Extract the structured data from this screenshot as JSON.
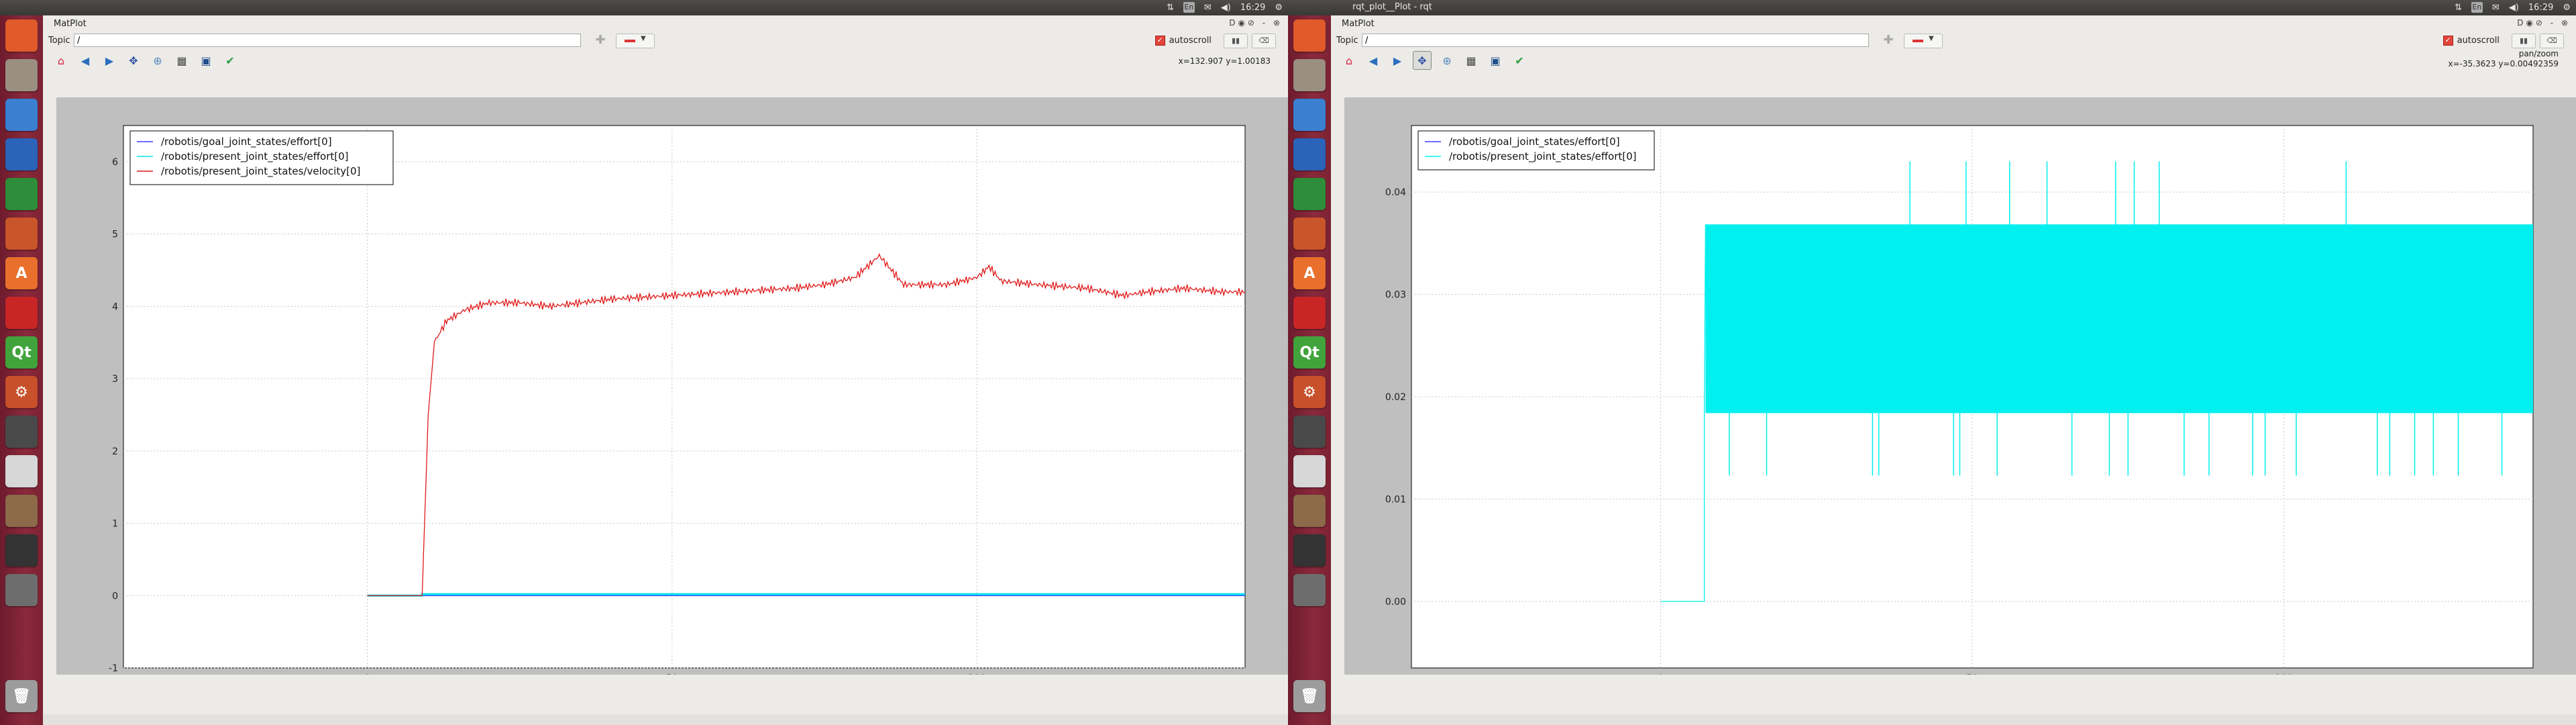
{
  "topbar": {
    "left_title": "",
    "right_title": "rqt_plot__Plot - rqt",
    "keyboard": "En",
    "clock": "16:29"
  },
  "launcher": {
    "items": [
      {
        "name": "dash",
        "label": "",
        "color": "#e05a2a"
      },
      {
        "name": "files",
        "label": "",
        "color": "#9a8f80"
      },
      {
        "name": "chromium",
        "label": "",
        "color": "#3a7fd0"
      },
      {
        "name": "writer",
        "label": "",
        "color": "#2a63b8"
      },
      {
        "name": "calc",
        "label": "",
        "color": "#2e8d3a"
      },
      {
        "name": "impress",
        "label": "",
        "color": "#c9552a"
      },
      {
        "name": "software-center",
        "label": "A",
        "color": "#e8702c"
      },
      {
        "name": "terminal-red",
        "label": "",
        "color": "#c82626"
      },
      {
        "name": "qt-creator",
        "label": "Qt",
        "color": "#41a33c"
      },
      {
        "name": "settings",
        "label": "⚙",
        "color": "#c8502a"
      },
      {
        "name": "eye",
        "label": "",
        "color": "#4a4a4a"
      },
      {
        "name": "editor",
        "label": "",
        "color": "#d7d7d7"
      },
      {
        "name": "gimp",
        "label": "",
        "color": "#8c6a4a"
      },
      {
        "name": "system-monitor",
        "label": "",
        "color": "#333"
      },
      {
        "name": "workspaces",
        "label": "",
        "color": "#6d6d6d"
      }
    ],
    "trash": "trash"
  },
  "windows": [
    {
      "title": "MatPlot",
      "topic_label": "Topic",
      "topic_value": "/",
      "autoscroll_label": "autoscroll",
      "coords": "x=132.907     y=1.00183",
      "coords_line1": "",
      "coords_line2": ""
    },
    {
      "title": "MatPlot",
      "topic_label": "Topic",
      "topic_value": "/",
      "autoscroll_label": "autoscroll",
      "coords": "",
      "coords_line1": "pan/zoom",
      "coords_line2": "x=-35.3623     y=0.00492359"
    }
  ],
  "chart_data": [
    {
      "type": "line",
      "xlim": [
        -40,
        144
      ],
      "ylim": [
        -1,
        6.5
      ],
      "xticks": [
        0,
        50,
        100
      ],
      "yticks": [
        -1,
        0,
        1,
        2,
        3,
        4,
        5,
        6
      ],
      "grid": true,
      "legend_position": "top-left",
      "series": [
        {
          "name": "/robotis/goal_joint_states/effort[0]",
          "color": "#3c3cff",
          "points": [
            [
              0,
              0
            ],
            [
              9,
              0
            ],
            [
              144,
              0
            ]
          ]
        },
        {
          "name": "/robotis/present_joint_states/effort[0]",
          "color": "#00e5ee",
          "points": [
            [
              0,
              0
            ],
            [
              9,
              0
            ],
            [
              9,
              0.02
            ],
            [
              144,
              0.02
            ]
          ]
        },
        {
          "name": "/robotis/present_joint_states/velocity[0]",
          "color": "#e01818",
          "points": [
            [
              0,
              0
            ],
            [
              9,
              0
            ],
            [
              10,
              2.5
            ],
            [
              11,
              3.5
            ],
            [
              13,
              3.8
            ],
            [
              16,
              3.95
            ],
            [
              20,
              4.05
            ],
            [
              25,
              4.05
            ],
            [
              30,
              4.0
            ],
            [
              35,
              4.05
            ],
            [
              40,
              4.1
            ],
            [
              50,
              4.15
            ],
            [
              60,
              4.2
            ],
            [
              70,
              4.25
            ],
            [
              75,
              4.3
            ],
            [
              80,
              4.4
            ],
            [
              84,
              4.7
            ],
            [
              86,
              4.5
            ],
            [
              88,
              4.3
            ],
            [
              95,
              4.3
            ],
            [
              100,
              4.4
            ],
            [
              102,
              4.55
            ],
            [
              104,
              4.35
            ],
            [
              110,
              4.3
            ],
            [
              118,
              4.25
            ],
            [
              124,
              4.15
            ],
            [
              128,
              4.2
            ],
            [
              134,
              4.25
            ],
            [
              140,
              4.2
            ],
            [
              144,
              4.2
            ]
          ]
        }
      ]
    },
    {
      "type": "line",
      "xlim": [
        -40,
        140
      ],
      "ylim": [
        -0.0065,
        0.0465
      ],
      "xticks": [
        0,
        50,
        100
      ],
      "yticks": [
        0.0,
        0.01,
        0.02,
        0.03,
        0.04
      ],
      "ytick_labels": [
        "0.00",
        "0.01",
        "0.02",
        "0.03",
        "0.04"
      ],
      "grid": true,
      "legend_position": "top-left",
      "series": [
        {
          "name": "/robotis/goal_joint_states/effort[0]",
          "color": "#3c3cff",
          "points": []
        },
        {
          "name": "/robotis/present_joint_states/effort[0]",
          "color": "#00f0f0",
          "points": [
            [
              0,
              0
            ],
            [
              7,
              0
            ],
            [
              7,
              0.0184
            ],
            [
              7.2,
              0.0368
            ],
            [
              140,
              0.0368
            ]
          ],
          "band": [
            0.0184,
            0.0368
          ],
          "upper_spikes": [
            40,
            49,
            56,
            62,
            73,
            76,
            80,
            110
          ],
          "upper_spike_value": 0.043,
          "lower_spikes": [
            11,
            17,
            34,
            35,
            47,
            48,
            54,
            66,
            72,
            75,
            84,
            88,
            95,
            97,
            102,
            115,
            117,
            121,
            124,
            128,
            135
          ],
          "lower_spike_value": 0.0123
        }
      ]
    }
  ]
}
